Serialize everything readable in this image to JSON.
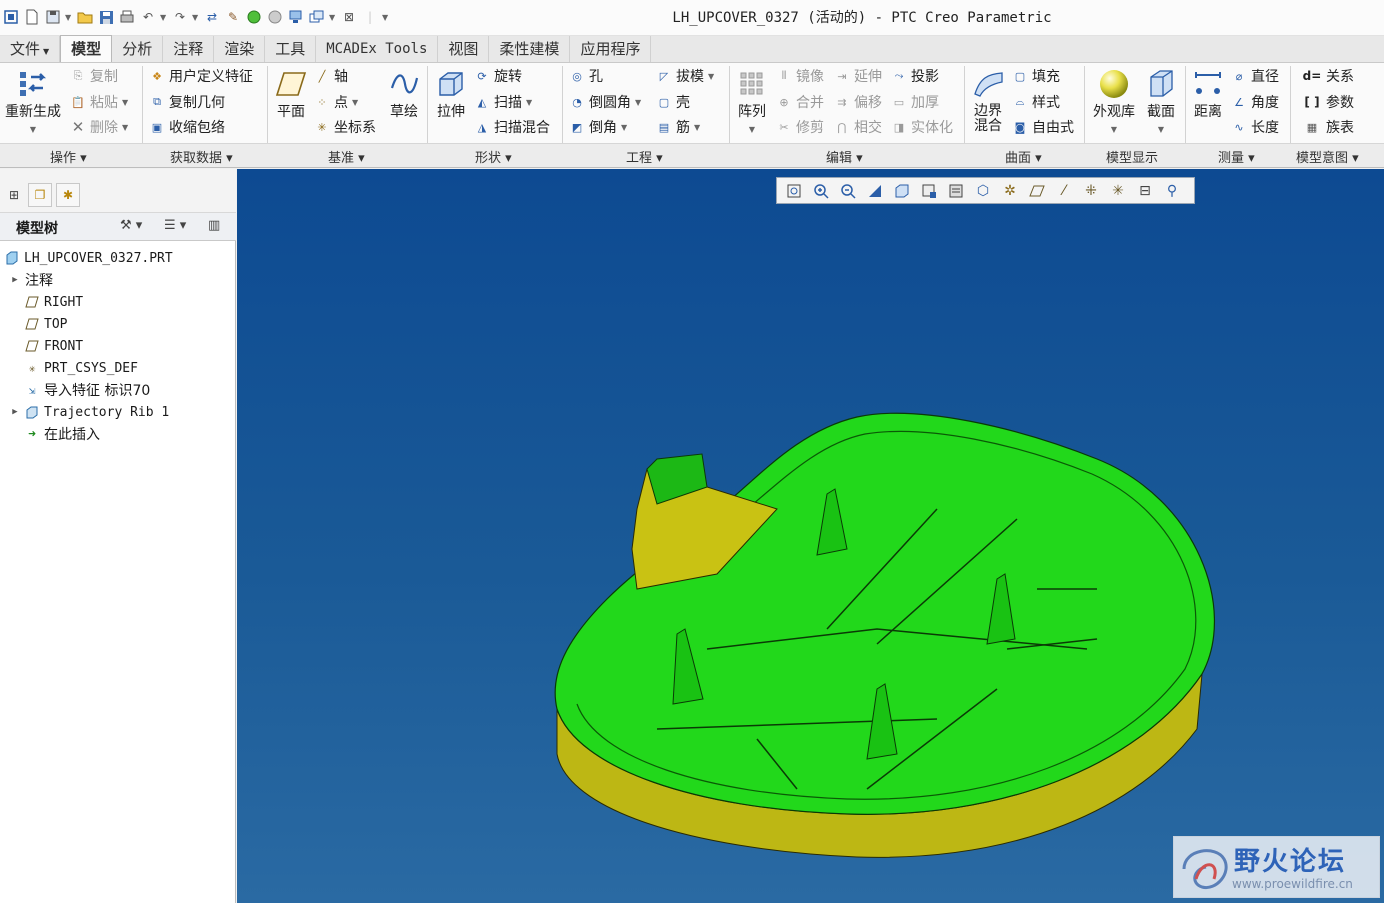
{
  "window": {
    "title": "LH_UPCOVER_0327 (活动的) - PTC Creo Parametric"
  },
  "tabs": [
    {
      "label": "文件",
      "file": true
    },
    {
      "label": "模型",
      "active": true
    },
    {
      "label": "分析"
    },
    {
      "label": "注释"
    },
    {
      "label": "渲染"
    },
    {
      "label": "工具"
    },
    {
      "label": "MCADEx Tools"
    },
    {
      "label": "视图"
    },
    {
      "label": "柔性建模"
    },
    {
      "label": "应用程序"
    }
  ],
  "ribbon": {
    "ops": {
      "regen": "重新生成",
      "copy": "复制",
      "paste": "粘贴",
      "delete": "删除"
    },
    "getdata": {
      "udf": "用户定义特征",
      "copygeom": "复制几何",
      "shrinkwrap": "收缩包络"
    },
    "datum": {
      "plane": "平面",
      "axis": "轴",
      "point": "点",
      "csys": "坐标系",
      "sketch": "草绘"
    },
    "shapes": {
      "extrude": "拉伸",
      "revolve": "旋转",
      "sweep": "扫描",
      "sweepblend": "扫描混合"
    },
    "eng": {
      "hole": "孔",
      "round": "倒圆角",
      "chamfer": "倒角",
      "draft": "拔模",
      "shell": "壳",
      "rib": "筋"
    },
    "edit": {
      "pattern": "阵列",
      "mirror": "镜像",
      "merge": "合并",
      "trim": "修剪",
      "extend": "延伸",
      "offset": "偏移",
      "intersect": "相交",
      "project": "投影",
      "thicken": "加厚",
      "solidify": "实体化"
    },
    "surfaces": {
      "boundary": "边界\n混合",
      "fill": "填充",
      "style": "样式",
      "freestyle": "自由式"
    },
    "display": {
      "appearance": "外观库",
      "section": "截面"
    },
    "measure": {
      "distance": "距离",
      "diameter": "直径",
      "angle": "角度",
      "length": "长度"
    },
    "intent": {
      "relations": "关系",
      "parameters": "参数",
      "familytable": "族表"
    }
  },
  "groups": {
    "ops": "操作",
    "getdata": "获取数据",
    "datum": "基准",
    "shapes": "形状",
    "eng": "工程",
    "edit": "编辑",
    "surfaces": "曲面",
    "display": "模型显示",
    "measure": "测量",
    "intent": "模型意图"
  },
  "tree": {
    "title": "模型树",
    "items": [
      {
        "label": "LH_UPCOVER_0327.PRT",
        "icon": "part-icon"
      },
      {
        "label": "注释",
        "icon": "none",
        "expand": true
      },
      {
        "label": "RIGHT",
        "icon": "datum-plane-icon"
      },
      {
        "label": "TOP",
        "icon": "datum-plane-icon"
      },
      {
        "label": "FRONT",
        "icon": "datum-plane-icon"
      },
      {
        "label": "PRT_CSYS_DEF",
        "icon": "csys-icon"
      },
      {
        "label": "导入特征 标识70",
        "icon": "import-feature-icon"
      },
      {
        "label": "Trajectory Rib 1",
        "icon": "rib-icon",
        "expand": true
      },
      {
        "label": "在此插入",
        "icon": "insert-here-arrow-icon"
      }
    ]
  },
  "watermark": {
    "cn": "野火论坛",
    "en": "www.proewildfire.cn"
  },
  "colors": {
    "viewport_top": "#0d4a92",
    "viewport_bottom": "#2a6aa3",
    "model_green": "#21d81a",
    "model_yellow": "#c9c213",
    "active_tab_bg": "#fbfbfb"
  }
}
